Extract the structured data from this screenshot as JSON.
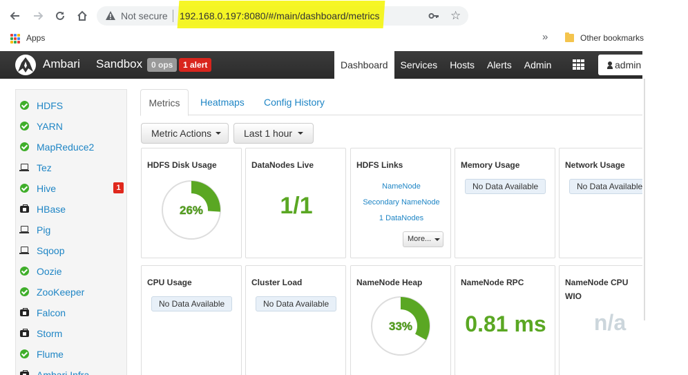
{
  "browser": {
    "security_label": "Not secure",
    "url": "192.168.0.197:8080/#/main/dashboard/metrics",
    "apps_label": "Apps",
    "more_bookmarks": "»",
    "other_bookmarks": "Other bookmarks",
    "highlight_color": "#f5f500"
  },
  "header": {
    "brand": "Ambari",
    "cluster": "Sandbox",
    "ops_badge": "0 ops",
    "alert_badge": "1 alert",
    "nav": [
      "Dashboard",
      "Services",
      "Hosts",
      "Alerts",
      "Admin"
    ],
    "active_nav": "Dashboard",
    "user": "admin"
  },
  "sidebar": {
    "services": [
      {
        "name": "HDFS",
        "status": "ok",
        "icon": "check-circle-icon"
      },
      {
        "name": "YARN",
        "status": "ok",
        "icon": "check-circle-icon"
      },
      {
        "name": "MapReduce2",
        "status": "ok",
        "icon": "check-circle-icon"
      },
      {
        "name": "Tez",
        "status": "client",
        "icon": "laptop-icon"
      },
      {
        "name": "Hive",
        "status": "ok",
        "icon": "check-circle-icon",
        "alerts": "1"
      },
      {
        "name": "HBase",
        "status": "maintenance",
        "icon": "medkit-icon"
      },
      {
        "name": "Pig",
        "status": "client",
        "icon": "laptop-icon"
      },
      {
        "name": "Sqoop",
        "status": "client",
        "icon": "laptop-icon"
      },
      {
        "name": "Oozie",
        "status": "ok",
        "icon": "check-circle-icon"
      },
      {
        "name": "ZooKeeper",
        "status": "ok",
        "icon": "check-circle-icon"
      },
      {
        "name": "Falcon",
        "status": "maintenance",
        "icon": "medkit-icon"
      },
      {
        "name": "Storm",
        "status": "maintenance",
        "icon": "medkit-icon"
      },
      {
        "name": "Flume",
        "status": "ok",
        "icon": "check-circle-icon"
      },
      {
        "name": "Ambari Infra",
        "status": "maintenance",
        "icon": "medkit-icon"
      }
    ]
  },
  "tabs": [
    "Metrics",
    "Heatmaps",
    "Config History"
  ],
  "actions": {
    "metric_actions": "Metric Actions",
    "time_range": "Last 1 hour"
  },
  "widgets": {
    "hdfs_disk_usage": {
      "title": "HDFS Disk Usage",
      "value": "26%",
      "percent": 26
    },
    "datanodes_live": {
      "title": "DataNodes Live",
      "value": "1/1"
    },
    "hdfs_links": {
      "title": "HDFS Links",
      "links": [
        "NameNode",
        "Secondary NameNode",
        "1 DataNodes"
      ],
      "more": "More..."
    },
    "memory_usage": {
      "title": "Memory Usage",
      "value": "No Data Available"
    },
    "network_usage": {
      "title": "Network Usage",
      "value": "No Data Available"
    },
    "cpu_usage": {
      "title": "CPU Usage",
      "value": "No Data Available"
    },
    "cluster_load": {
      "title": "Cluster Load",
      "value": "No Data Available"
    },
    "namenode_heap": {
      "title": "NameNode Heap",
      "value": "33%",
      "percent": 33
    },
    "namenode_rpc": {
      "title": "NameNode RPC",
      "value": "0.81 ms"
    },
    "namenode_cpu_wio": {
      "title": "NameNode CPU WIO",
      "value": "n/a"
    }
  },
  "colors": {
    "accent": "#1e85c5",
    "ok": "#3fae2a",
    "gauge": "#5aa723",
    "alert": "#d9251d"
  }
}
